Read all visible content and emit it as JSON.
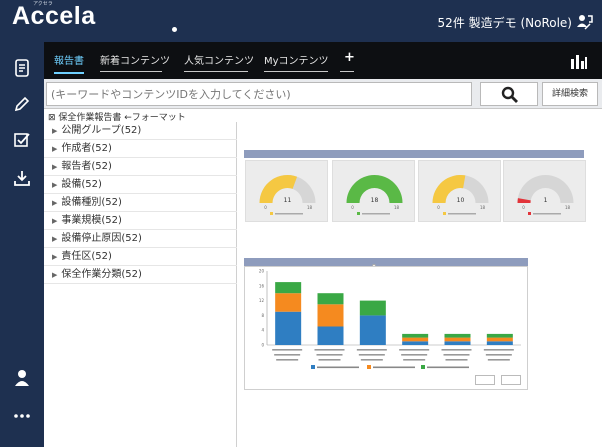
{
  "app": {
    "logo": "Accela",
    "logo_ruby": "アクセラ",
    "user_info": "52件 製造デモ (NoRole)"
  },
  "tabs": [
    {
      "label": "報告書",
      "active": true
    },
    {
      "label": "新着コンテンツ",
      "active": false
    },
    {
      "label": "人気コンテンツ",
      "active": false
    },
    {
      "label": "Myコンテンツ",
      "active": false
    }
  ],
  "tab_add": "+",
  "search": {
    "placeholder": "(キーワードやコンテンツIDを入力してください)",
    "advanced_label": "詳細検索"
  },
  "breadcrumb": "⊠ 保全作業報告書 ←フォーマット",
  "tree": [
    "公開グループ(52)",
    "作成者(52)",
    "報告者(52)",
    "設備(52)",
    "設備種別(52)",
    "事業規模(52)",
    "設備停止原因(52)",
    "責任区(52)",
    "保全作業分類(52)"
  ],
  "colors": {
    "topbar": "#1e3050",
    "tab_active": "#6fd0ff",
    "gauge_yellow": "#f5c842",
    "gauge_green": "#5ab946",
    "gauge_red": "#e2343a",
    "bar_blue": "#2f7ec2",
    "bar_orange": "#f58a1f",
    "bar_green": "#3aa845"
  },
  "icons": {
    "rail": [
      "document-icon",
      "pencil-icon",
      "checkbox-icon",
      "download-icon",
      "user-icon",
      "more-icon"
    ],
    "search": "search-icon",
    "chart": "bar-chart-icon",
    "user_top": "user-network-icon"
  },
  "chart_data": [
    {
      "type": "gauge",
      "gauges": [
        {
          "value": 11,
          "min": 0,
          "max": 18,
          "color": "#f5c842"
        },
        {
          "value": 18,
          "min": 0,
          "max": 18,
          "color": "#5ab946"
        },
        {
          "value": 10,
          "min": 0,
          "max": 18,
          "color": "#f5c842"
        },
        {
          "value": 1,
          "min": 0,
          "max": 18,
          "color": "#e2343a"
        }
      ]
    },
    {
      "type": "bar",
      "stacked": true,
      "categories": [
        "1",
        "2",
        "3",
        "4",
        "5",
        "6"
      ],
      "series": [
        {
          "color": "#2f7ec2",
          "values": [
            9,
            5,
            8,
            1,
            1,
            1
          ]
        },
        {
          "color": "#f58a1f",
          "values": [
            5,
            6,
            0,
            1,
            1,
            1
          ]
        },
        {
          "color": "#3aa845",
          "values": [
            3,
            3,
            4,
            1,
            1,
            1
          ]
        }
      ],
      "ylim": [
        0,
        20
      ]
    }
  ]
}
